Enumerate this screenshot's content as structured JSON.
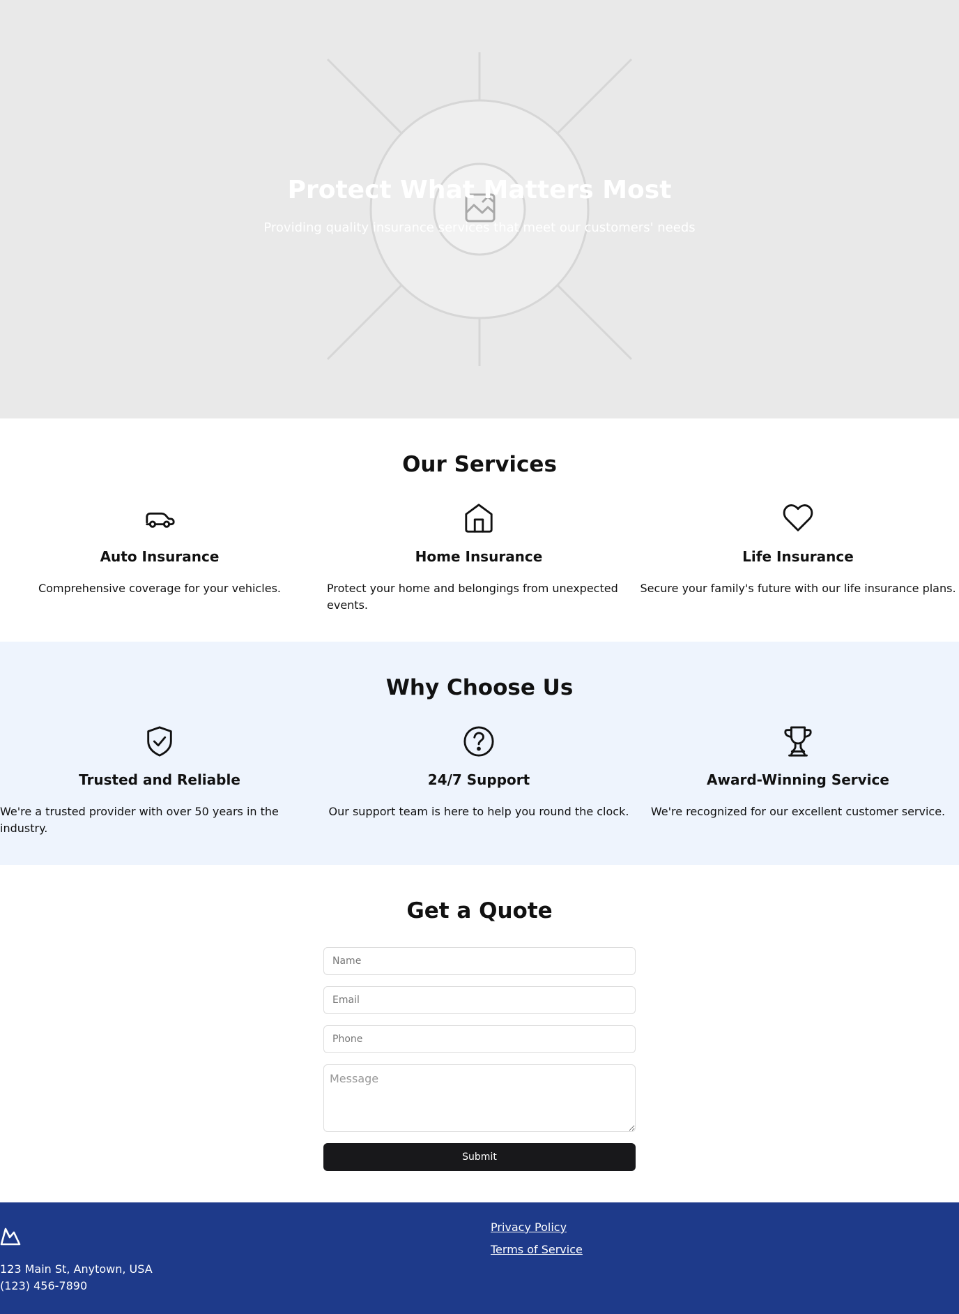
{
  "hero": {
    "title": "Protect What Matters Most",
    "subtitle": "Providing quality insurance services that meet our customers' needs",
    "image_icon": "image-placeholder-icon"
  },
  "services": {
    "title": "Our Services",
    "items": [
      {
        "icon": "car-icon",
        "title": "Auto Insurance",
        "text": "Comprehensive coverage for your vehicles."
      },
      {
        "icon": "home-icon",
        "title": "Home Insurance",
        "text": "Protect your home and belongings from unexpected events."
      },
      {
        "icon": "heart-icon",
        "title": "Life Insurance",
        "text": "Secure your family's future with our life insurance plans."
      }
    ]
  },
  "why": {
    "title": "Why Choose Us",
    "items": [
      {
        "icon": "shield-check-icon",
        "title": "Trusted and Reliable",
        "text": "We're a trusted provider with over 50 years in the industry."
      },
      {
        "icon": "help-circle-icon",
        "title": "24/7 Support",
        "text": "Our support team is here to help you round the clock."
      },
      {
        "icon": "trophy-icon",
        "title": "Award-Winning Service",
        "text": "We're recognized for our excellent customer service."
      }
    ]
  },
  "quote": {
    "title": "Get a Quote",
    "name_placeholder": "Name",
    "email_placeholder": "Email",
    "phone_placeholder": "Phone",
    "message_placeholder": "Message",
    "submit_label": "Submit"
  },
  "footer": {
    "logo_icon": "mountain-logo-icon",
    "address": "123 Main St, Anytown, USA",
    "phone": "(123) 456-7890",
    "links": [
      "Privacy Policy",
      "Terms of Service"
    ]
  },
  "colors": {
    "hero_bg": "#e9e9e9",
    "why_bg": "#eef4fd",
    "footer_bg": "#1e3a8a",
    "button_bg": "#18181b"
  }
}
